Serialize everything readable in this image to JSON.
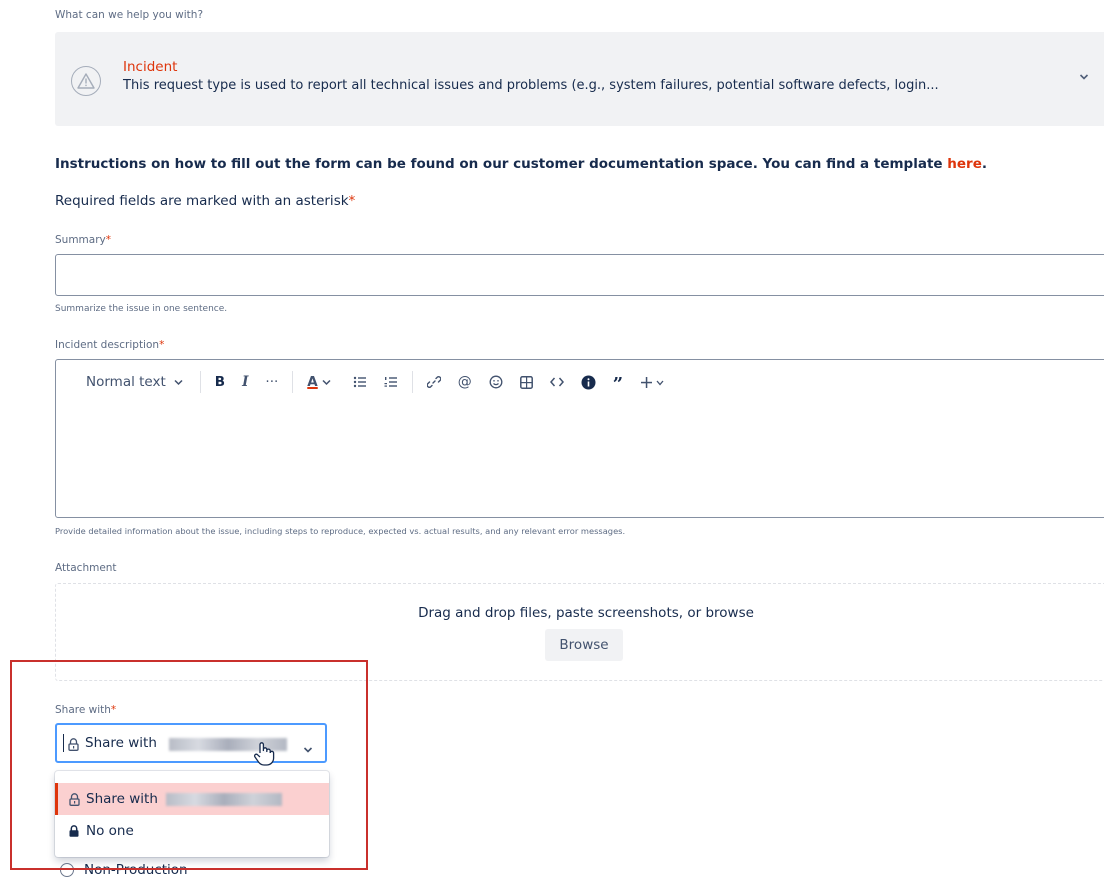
{
  "request_type": {
    "prompt": "What can we help you with?",
    "title": "Incident",
    "description": "This request type is used to report all technical issues and problems (e.g., system failures, potential software defects, login..."
  },
  "instructions": {
    "text": "Instructions on how to fill out the form can be found on our customer documentation space. You can find a template ",
    "link": "here",
    "end": "."
  },
  "required_note": {
    "text": "Required fields are marked with an asterisk",
    "asterisk": "*"
  },
  "summary": {
    "label": "Summary",
    "asterisk": "*",
    "value": "",
    "helper": "Summarize the issue in one sentence."
  },
  "description": {
    "label": "Incident description",
    "asterisk": "*",
    "helper": "Provide detailed information about the issue, including steps to reproduce, expected vs. actual results, and any relevant error messages.",
    "toolbar": {
      "text_style": "Normal text",
      "bold": "B",
      "italic": "I",
      "more": "···",
      "text_color": "A",
      "icons": [
        "bullet-list-icon",
        "numbered-list-icon",
        "link-icon",
        "mention-icon",
        "emoji-icon",
        "table-icon",
        "code-icon",
        "info-icon",
        "quote-icon",
        "insert-plus-icon"
      ]
    }
  },
  "attachment": {
    "label": "Attachment",
    "drop_text": "Drag and drop files, paste screenshots, or browse",
    "browse_label": "Browse"
  },
  "share_with": {
    "label": "Share with",
    "asterisk": "*",
    "selected": "Share with",
    "options": [
      {
        "label": "Share with",
        "state": "highlighted"
      },
      {
        "label": "No one",
        "state": "normal"
      }
    ]
  },
  "partial_option": {
    "label": "Non-Production"
  },
  "colors": {
    "accent": "#de350b",
    "focus": "#4c9aff",
    "highlight_box": "#c9302c"
  }
}
